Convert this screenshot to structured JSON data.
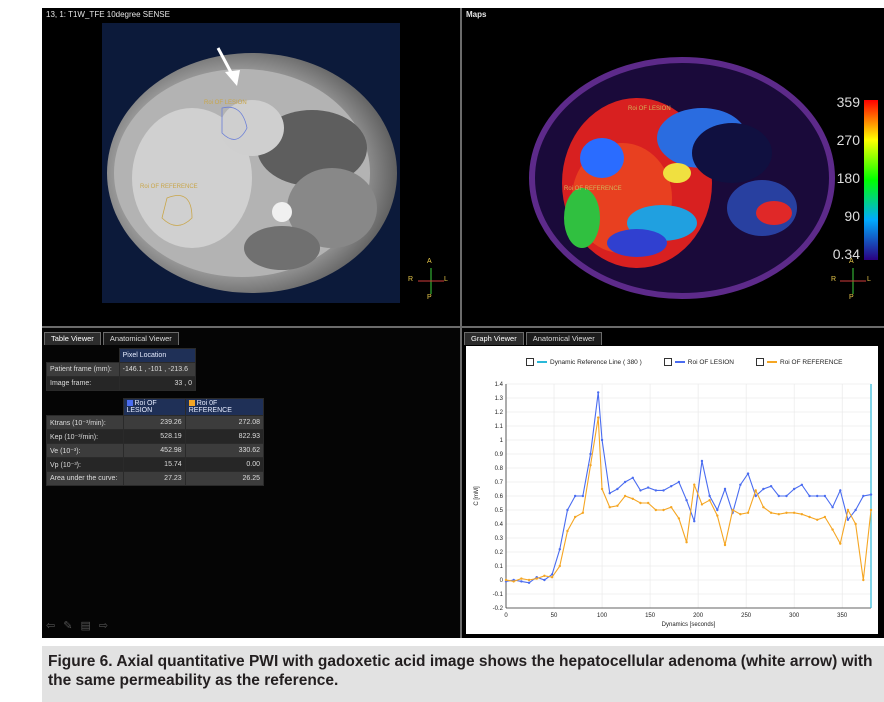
{
  "viewer": {
    "top_left": {
      "title": "13, 1: T1W_TFE 10degree SENSE",
      "roi_lesion": "Roi OF LESION",
      "roi_reference": "Roi OF REFERENCE",
      "orient": {
        "top": "A",
        "left": "R",
        "right": "L",
        "bottom": "P"
      }
    },
    "top_right": {
      "title": "Maps",
      "roi_lesion": "Roi OF LESION",
      "roi_reference": "Roi OF REFERENCE",
      "colorbar_ticks": [
        "359",
        "270",
        "180",
        "90",
        "0.34"
      ],
      "orient": {
        "top": "A",
        "left": "R",
        "right": "L",
        "bottom": "P"
      }
    },
    "bottom_left": {
      "tabs": [
        "Table Viewer",
        "Anatomical Viewer"
      ],
      "pixel_header": "Pixel Location",
      "patient_frame_label": "Patient frame (mm):",
      "patient_frame_value": "-146.1 , -101 , -213.6",
      "image_frame_label": "Image frame:",
      "image_frame_value": "33 , 0",
      "col_lesion": "Roi OF LESION",
      "col_reference": "Roi 0F REFERENCE",
      "rows": [
        {
          "label": "Ktrans (10⁻³/min):",
          "lesion": "239.26",
          "reference": "272.08"
        },
        {
          "label": "Kep (10⁻³/min):",
          "lesion": "528.19",
          "reference": "822.93"
        },
        {
          "label": "Ve (10⁻³):",
          "lesion": "452.98",
          "reference": "330.62"
        },
        {
          "label": "Vp (10⁻³):",
          "lesion": "15.74",
          "reference": "0.00"
        },
        {
          "label": "Area under the curve:",
          "lesion": "27.23",
          "reference": "26.25"
        }
      ],
      "toolbar_icons": [
        "arrow-left-icon",
        "pencil-icon",
        "grid-icon",
        "arrow-right-icon"
      ]
    },
    "bottom_right": {
      "tabs": [
        "Graph Viewer",
        "Anatomical Viewer"
      ],
      "legend": [
        "Dynamic Reference Line ( 380 )",
        "Roi OF LESION",
        "Roi OF REFERENCE"
      ]
    }
  },
  "colors": {
    "lesion": "#4a6cf0",
    "reference": "#f5a623",
    "reference_line": "#2ab8d8",
    "table_header": "#1f3057"
  },
  "chart_data": {
    "type": "line",
    "xlabel": "Dynamics [seconds]",
    "ylabel": "C [mM]",
    "xlim": [
      0,
      380
    ],
    "ylim": [
      -0.2,
      1.4
    ],
    "xticks": [
      0,
      50,
      100,
      150,
      200,
      250,
      300,
      350
    ],
    "yticks": [
      -0.2,
      -0.1,
      0,
      0.1,
      0.2,
      0.3,
      0.4,
      0.5,
      0.6,
      0.7,
      0.8,
      0.9,
      1,
      1.1,
      1.2,
      1.3,
      1.4
    ],
    "series": [
      {
        "name": "Roi OF LESION",
        "color": "#4a6cf0",
        "x": [
          0,
          8,
          16,
          24,
          32,
          40,
          48,
          56,
          64,
          72,
          80,
          88,
          96,
          100,
          108,
          116,
          124,
          132,
          140,
          148,
          156,
          164,
          172,
          180,
          188,
          196,
          204,
          212,
          220,
          228,
          236,
          244,
          252,
          260,
          268,
          276,
          284,
          292,
          300,
          308,
          316,
          324,
          332,
          340,
          348,
          356,
          364,
          372,
          380
        ],
        "y": [
          -0.01,
          0.0,
          -0.01,
          -0.02,
          0.02,
          0.0,
          0.04,
          0.22,
          0.5,
          0.6,
          0.6,
          0.9,
          1.34,
          1.0,
          0.62,
          0.65,
          0.7,
          0.73,
          0.64,
          0.66,
          0.64,
          0.64,
          0.67,
          0.7,
          0.57,
          0.42,
          0.85,
          0.6,
          0.5,
          0.65,
          0.48,
          0.68,
          0.76,
          0.6,
          0.65,
          0.67,
          0.6,
          0.6,
          0.65,
          0.68,
          0.6,
          0.6,
          0.6,
          0.52,
          0.64,
          0.43,
          0.5,
          0.6,
          0.61
        ]
      },
      {
        "name": "Roi OF REFERENCE",
        "color": "#f5a623",
        "x": [
          0,
          8,
          16,
          24,
          32,
          40,
          48,
          56,
          64,
          72,
          80,
          88,
          96,
          100,
          108,
          116,
          124,
          132,
          140,
          148,
          156,
          164,
          172,
          180,
          188,
          196,
          204,
          212,
          220,
          228,
          236,
          244,
          252,
          260,
          268,
          276,
          284,
          292,
          300,
          308,
          316,
          324,
          332,
          340,
          348,
          356,
          364,
          372,
          380
        ],
        "y": [
          0.0,
          -0.01,
          0.01,
          0.0,
          0.01,
          0.03,
          0.02,
          0.1,
          0.35,
          0.45,
          0.48,
          0.82,
          1.16,
          0.65,
          0.52,
          0.53,
          0.6,
          0.58,
          0.55,
          0.55,
          0.5,
          0.5,
          0.52,
          0.44,
          0.27,
          0.68,
          0.54,
          0.57,
          0.46,
          0.25,
          0.5,
          0.47,
          0.48,
          0.64,
          0.52,
          0.48,
          0.47,
          0.48,
          0.48,
          0.47,
          0.45,
          0.43,
          0.45,
          0.36,
          0.26,
          0.5,
          0.4,
          0.0,
          0.5
        ]
      }
    ]
  },
  "caption": "Figure 6. Axial quantitative PWI with gadoxetic acid image shows the hepatocellular adenoma (white arrow) with the same permeability as the reference."
}
